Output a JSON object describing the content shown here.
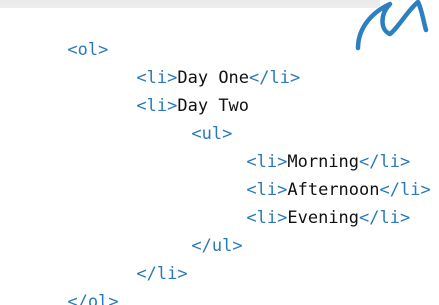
{
  "code": {
    "lines": [
      {
        "indent": 0,
        "open": "<ol>",
        "text": "",
        "close": ""
      },
      {
        "indent": 1,
        "open": "<li>",
        "text": "Day One",
        "close": "</li>"
      },
      {
        "indent": 1,
        "open": "<li>",
        "text": "Day Two",
        "close": ""
      },
      {
        "indent": 2,
        "open": "<ul>",
        "text": "",
        "close": ""
      },
      {
        "indent": 3,
        "open": "<li>",
        "text": "Morning",
        "close": "</li>"
      },
      {
        "indent": 3,
        "open": "<li>",
        "text": "Afternoon",
        "close": "</li>"
      },
      {
        "indent": 3,
        "open": "<li>",
        "text": "Evening",
        "close": "</li>"
      },
      {
        "indent": 2,
        "open": "</ul>",
        "text": "",
        "close": ""
      },
      {
        "indent": 1,
        "open": "</li>",
        "text": "",
        "close": ""
      },
      {
        "indent": 0,
        "open": "</ol>",
        "text": "",
        "close": ""
      }
    ]
  },
  "colors": {
    "tag": "#2a7ab8",
    "text": "#111111",
    "scribble": "#2e7fbf"
  },
  "decorations": {
    "scribble_icon": "handwritten-wave-scribble"
  }
}
